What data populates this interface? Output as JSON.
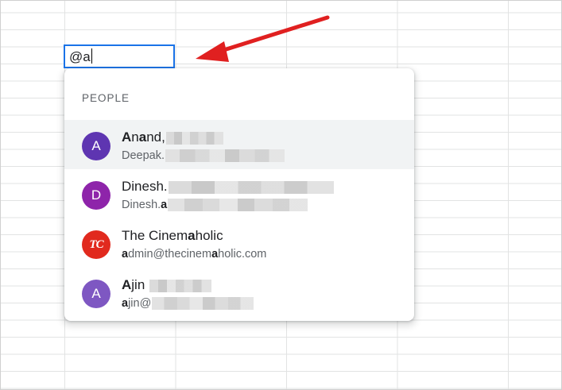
{
  "cell": {
    "value": "@a"
  },
  "popup": {
    "section_label": "PEOPLE"
  },
  "people": [
    {
      "avatar_letter": "A",
      "avatar_color": "#5e35b1",
      "name_bold_1": "A",
      "name_rest_1": "n",
      "name_bold_2": "a",
      "name_rest_2": "nd,",
      "email_text": "Deepak."
    },
    {
      "avatar_letter": "D",
      "avatar_color": "#8e24aa",
      "name_text": "Dinesh.",
      "email_text": "Dinesh.",
      "email_bold": "a"
    },
    {
      "avatar_logo": "TC",
      "avatar_color": "#e12a1e",
      "name_text_1": "The Cinem",
      "name_bold": "a",
      "name_text_2": "holic",
      "email_bold_1": "a",
      "email_text_1": "dmin@thecinem",
      "email_bold_2": "a",
      "email_text_2": "holic.com"
    },
    {
      "avatar_letter": "A",
      "avatar_color": "#7e57c2",
      "name_bold": "A",
      "name_text": "jin",
      "email_bold": "a",
      "email_text": "jin@"
    }
  ],
  "colors": {
    "selection_border": "#1a73e8",
    "arrow": "#e02020",
    "highlight_row": "#f1f3f4"
  }
}
